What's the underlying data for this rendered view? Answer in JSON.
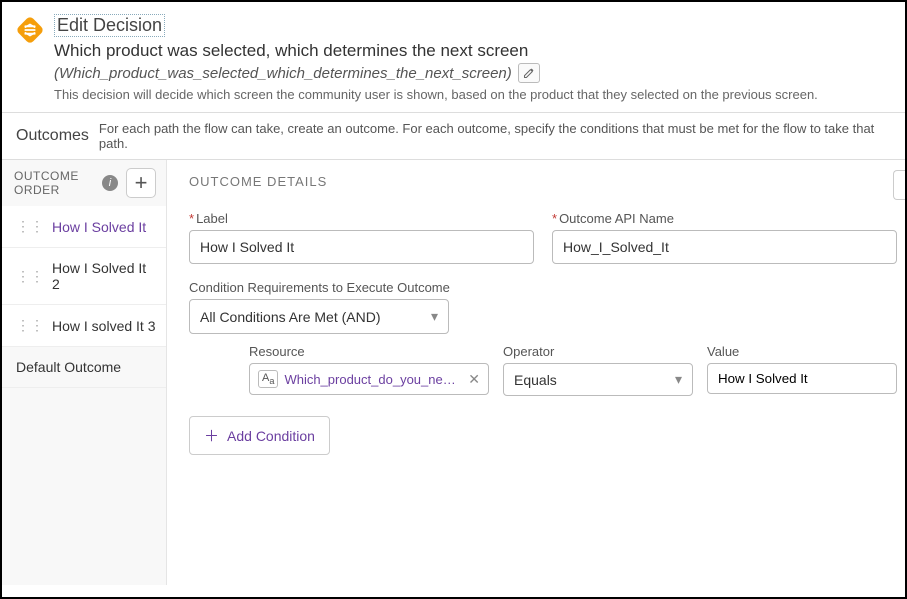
{
  "header": {
    "title": "Edit Decision",
    "subtitle": "Which product was selected, which determines the next screen",
    "api_name": "(Which_product_was_selected_which_determines_the_next_screen)",
    "description": "This decision will decide which screen the community user is shown, based on the product that they selected on the previous screen."
  },
  "outcomes_bar": {
    "label": "Outcomes",
    "help": "For each path the flow can take, create an outcome. For each outcome, specify the conditions that must be met for the flow to take that path."
  },
  "sidebar": {
    "order_label": "OUTCOME ORDER",
    "add_label": "+",
    "items": [
      {
        "label": "How I Solved It",
        "selected": true,
        "draggable": true
      },
      {
        "label": "How I Solved It 2",
        "selected": false,
        "draggable": true
      },
      {
        "label": "How I solved It 3",
        "selected": false,
        "draggable": true
      },
      {
        "label": "Default Outcome",
        "selected": false,
        "draggable": false
      }
    ]
  },
  "details": {
    "heading": "OUTCOME DETAILS",
    "label_field": {
      "label": "Label",
      "value": "How I Solved It"
    },
    "api_field": {
      "label": "Outcome API Name",
      "value": "How_I_Solved_It"
    },
    "cond_req": {
      "label": "Condition Requirements to Execute Outcome",
      "selected": "All Conditions Are Met (AND)"
    },
    "condition": {
      "resource_label": "Resource",
      "resource_value": "Which_product_do_you_need_s...",
      "operator_label": "Operator",
      "operator_value": "Equals",
      "value_label": "Value",
      "value_value": "How I Solved It"
    },
    "add_condition_label": "Add Condition"
  }
}
